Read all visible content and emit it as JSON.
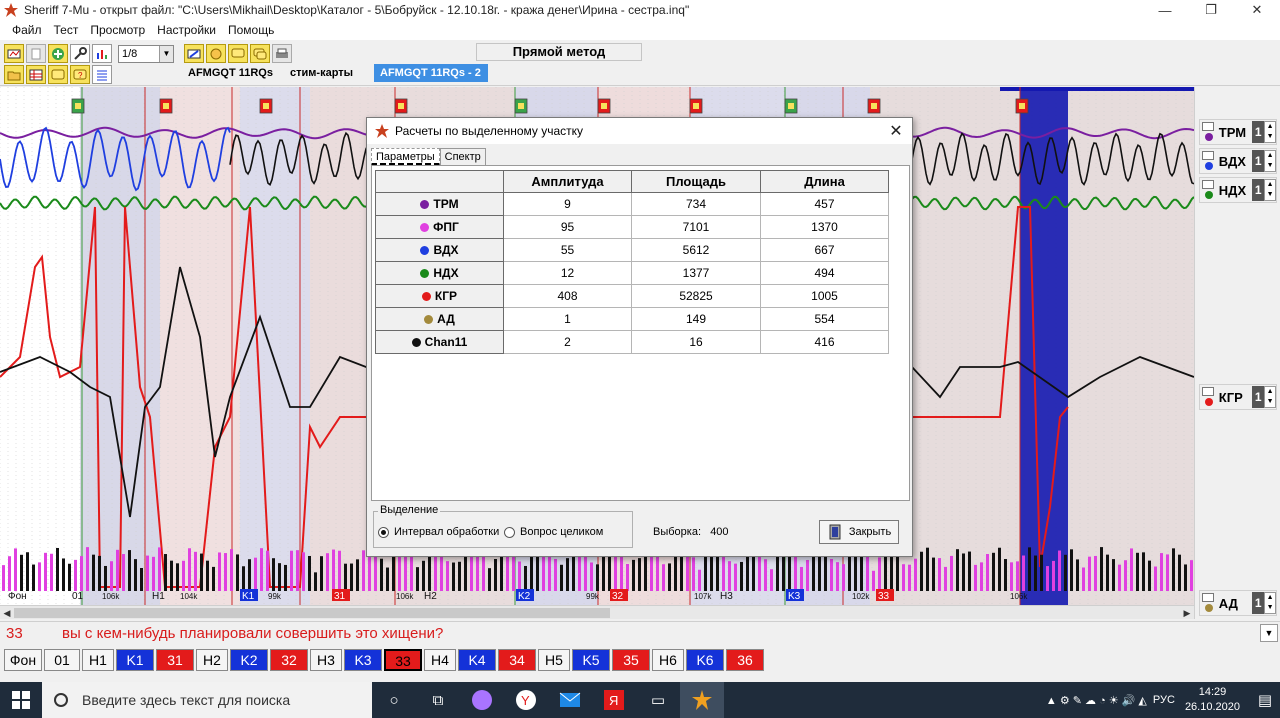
{
  "window": {
    "title": "Sheriff 7-Mu - открыт файл: \"C:\\Users\\Mikhail\\Desktop\\Каталог - 5\\Бобруйск - 12.10.18г. - кража денег\\Ирина - сестра.inq\"",
    "minimize": "—",
    "maximize": "❐",
    "close": "✕"
  },
  "menu": [
    "Файл",
    "Тест",
    "Просмотр",
    "Настройки",
    "Помощь"
  ],
  "toolbar": {
    "chart_select": "1/8",
    "method_label": "Прямой метод",
    "tabs": [
      {
        "label": "AFMGQT 11RQs",
        "active": false
      },
      {
        "label": "стим-карты",
        "active": false
      },
      {
        "label": "AFMGQT 11RQs  - 2",
        "active": true
      }
    ]
  },
  "chart": {
    "markers": [
      "Фон",
      "01",
      "106k",
      "H1",
      "104k",
      "K1",
      "99k",
      "31",
      "106k",
      "H2",
      "K2",
      "99k",
      "32",
      "107k",
      "H3",
      "K3",
      "102k",
      "33",
      "106k"
    ],
    "colors": {
      "trm": "#7a1fa0",
      "vdx": "#1f3fe0",
      "ndx": "#1a8a1a",
      "kgr": "#e31b1b",
      "ad": "#a38a3c",
      "chan11": "#111111",
      "fpg": "#e040e0",
      "selection": "#1418b0"
    }
  },
  "channels": [
    {
      "name": "ТРМ",
      "value": "1",
      "color": "#7a1fa0"
    },
    {
      "name": "ВДХ",
      "value": "1",
      "color": "#1f3fe0"
    },
    {
      "name": "НДХ",
      "value": "1",
      "color": "#1a8a1a"
    },
    {
      "name": "КГР",
      "value": "1",
      "color": "#e31b1b"
    },
    {
      "name": "АД",
      "value": "1",
      "color": "#a38a3c"
    }
  ],
  "dialog": {
    "title": "Расчеты по выделенному участку",
    "tabs": [
      "Параметры",
      "Спектр"
    ],
    "columns": [
      "Амплитуда",
      "Площадь",
      "Длина"
    ],
    "rows": [
      {
        "name": "ТРМ",
        "color": "#7a1fa0",
        "values": [
          "9",
          "734",
          "457"
        ]
      },
      {
        "name": "ФПГ",
        "color": "#e040e0",
        "values": [
          "95",
          "7101",
          "1370"
        ]
      },
      {
        "name": "ВДХ",
        "color": "#1f3fe0",
        "values": [
          "55",
          "5612",
          "667"
        ]
      },
      {
        "name": "НДХ",
        "color": "#1a8a1a",
        "values": [
          "12",
          "1377",
          "494"
        ]
      },
      {
        "name": "КГР",
        "color": "#e31b1b",
        "values": [
          "408",
          "52825",
          "1005"
        ]
      },
      {
        "name": "АД",
        "color": "#a38a3c",
        "values": [
          "1",
          "149",
          "554"
        ]
      },
      {
        "name": "Chan11",
        "color": "#111111",
        "values": [
          "2",
          "16",
          "416"
        ]
      }
    ],
    "selection_group": "Выделение",
    "radio_interval": "Интервал обработки",
    "radio_question": "Вопрос целиком",
    "sample_label": "Выборка:",
    "sample_value": "400",
    "close_button": "Закрыть"
  },
  "question": {
    "number": "33",
    "text": "вы с кем-нибудь планировали совершить это хищени?"
  },
  "question_buttons": [
    {
      "label": "Фон",
      "style": "plain"
    },
    {
      "label": "01",
      "style": "plain"
    },
    {
      "label": "H1",
      "style": "plain"
    },
    {
      "label": "K1",
      "style": "blue"
    },
    {
      "label": "31",
      "style": "red"
    },
    {
      "label": "H2",
      "style": "plain"
    },
    {
      "label": "K2",
      "style": "blue"
    },
    {
      "label": "32",
      "style": "red"
    },
    {
      "label": "H3",
      "style": "plain"
    },
    {
      "label": "K3",
      "style": "blue"
    },
    {
      "label": "33",
      "style": "selected"
    },
    {
      "label": "H4",
      "style": "plain"
    },
    {
      "label": "K4",
      "style": "blue"
    },
    {
      "label": "34",
      "style": "red"
    },
    {
      "label": "H5",
      "style": "plain"
    },
    {
      "label": "K5",
      "style": "blue"
    },
    {
      "label": "35",
      "style": "red"
    },
    {
      "label": "H6",
      "style": "plain"
    },
    {
      "label": "K6",
      "style": "blue"
    },
    {
      "label": "36",
      "style": "red"
    }
  ],
  "taskbar": {
    "search_placeholder": "Введите здесь текст для поиска",
    "lang": "РУС",
    "time": "14:29",
    "date": "26.10.2020"
  }
}
